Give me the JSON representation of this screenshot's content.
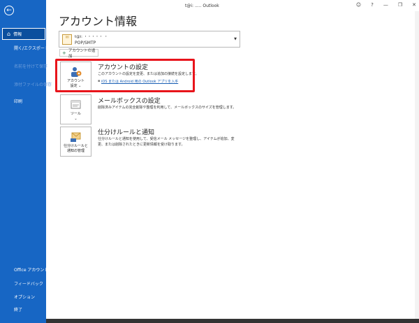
{
  "window": {
    "title": "t@i: ..... Outlook",
    "controls": [
      "person-icon",
      "help-icon",
      "minimize-icon",
      "restore-icon",
      "close-icon"
    ]
  },
  "sidebar": {
    "back_icon": "back-arrow-icon",
    "items": [
      {
        "label": "情報",
        "active": true,
        "enabled": true
      },
      {
        "label": "開く/エクスポート",
        "active": false,
        "enabled": true
      },
      {
        "label": "名前を付けて保存",
        "active": false,
        "enabled": false
      },
      {
        "label": "添付ファイルの保存",
        "active": false,
        "enabled": false
      },
      {
        "label": "印刷",
        "active": false,
        "enabled": true
      }
    ],
    "bottom_items": [
      {
        "label": "Office アカウント"
      },
      {
        "label": "フィードバック"
      },
      {
        "label": "オプション"
      },
      {
        "label": "終了"
      }
    ]
  },
  "page_title": "アカウント情報",
  "account": {
    "email": "t@i: ・・・・・ ・",
    "type": "POP/SMTP",
    "add_label": "アカウントの追加"
  },
  "cards": {
    "settings": {
      "button_label": "アカウント\n設定 ⌄",
      "title": "アカウントの設定",
      "desc": "このアカウントの設定を変更、または追加の接続を設定します。",
      "link": "iOS または Android 用の Outlook アプリを入手"
    },
    "mailbox": {
      "button_label": "ツール\n⌄",
      "title": "メールボックスの設定",
      "desc": "削除済みアイテムの完全削除や整理を利用して、メールボックスのサイズを管理します。"
    },
    "rules": {
      "button_label": "仕分けルールと\n通知の管理",
      "title": "仕分けルールと通知",
      "desc": "仕分けルールと通知を使用して、受信メール メッセージを整理し、アイテムが追加、変更、または削除されたときに更新情報を受け取ります。"
    }
  },
  "colors": {
    "sidebar_bg": "#1766c4",
    "highlight": "#e8141b",
    "link": "#1a5fb4"
  }
}
